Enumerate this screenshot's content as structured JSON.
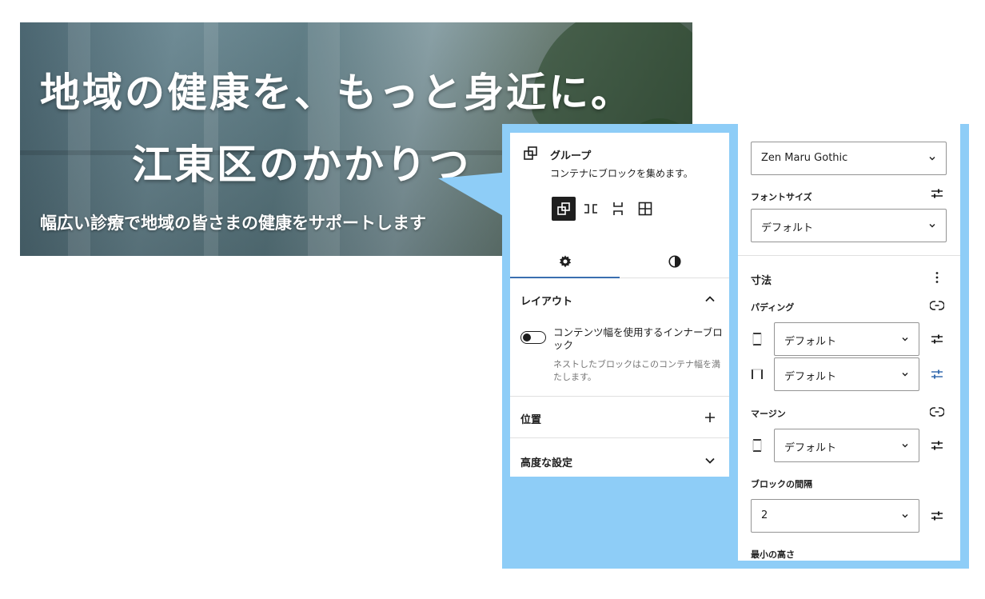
{
  "hero": {
    "headline_line1": "地域の健康を、もっと身近に。",
    "headline_line2": "江東区のかかりつ",
    "subline": "幅広い診療で地域の皆さまの健康をサポートします"
  },
  "block_card": {
    "title": "グループ",
    "description": "コンテナにブロックを集めます。",
    "variations": [
      "group-icon",
      "row-icon",
      "stack-icon",
      "grid-icon"
    ],
    "tabs": [
      "settings-gear-icon",
      "styles-contrast-icon"
    ]
  },
  "layout_panel": {
    "title": "レイアウト",
    "toggle_label": "コンテンツ幅を使用するインナーブロック",
    "toggle_on": false,
    "help": "ネストしたブロックはこのコンテナ幅を満たします。"
  },
  "position_panel": {
    "title": "位置"
  },
  "advanced_panel": {
    "title": "高度な設定"
  },
  "typography": {
    "font_family_value": "Zen Maru Gothic",
    "font_size_label": "フォントサイズ",
    "font_size_value": "デフォルト"
  },
  "dimensions": {
    "title": "寸法",
    "padding_label": "パディング",
    "padding_vertical_value": "デフォルト",
    "padding_horizontal_value": "デフォルト",
    "margin_label": "マージン",
    "margin_value": "デフォルト",
    "block_spacing_label": "ブロックの間隔",
    "block_spacing_value": "2",
    "min_height_label": "最小の高さ"
  },
  "colors": {
    "frame": "#8ecdf7",
    "accent": "#3a6fb0",
    "text": "#1e1e1e",
    "muted": "#757575"
  }
}
